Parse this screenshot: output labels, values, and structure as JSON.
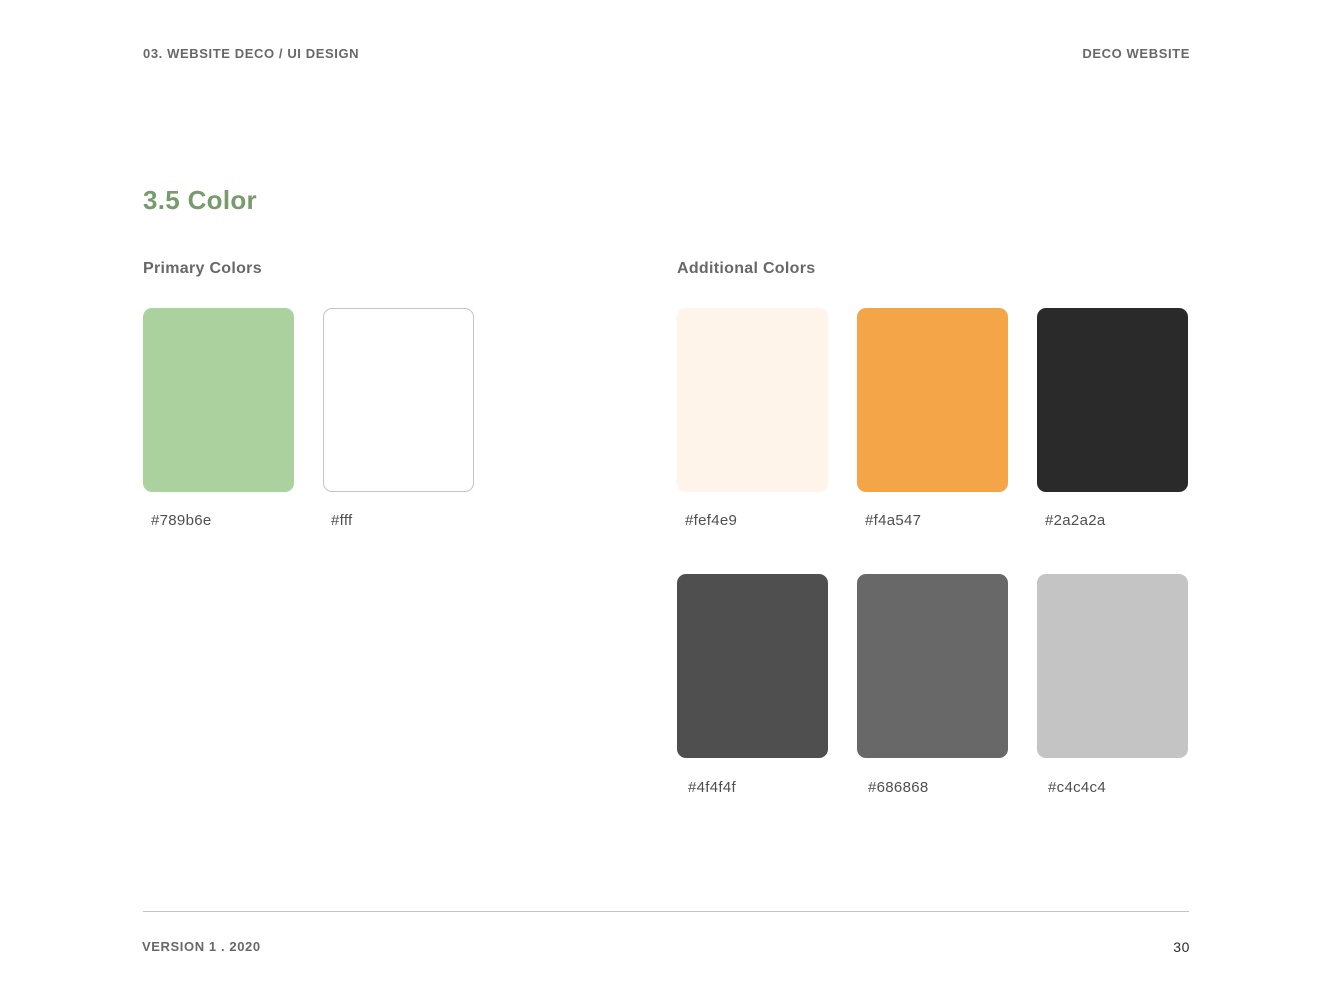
{
  "header": {
    "left": "03. WEBSITE DECO / UI DESIGN",
    "right": "DECO WEBSITE"
  },
  "section": {
    "title": "3.5 Color"
  },
  "primary": {
    "title": "Primary Colors",
    "colors": [
      {
        "label": "#789b6e",
        "fill": "#abd19e"
      },
      {
        "label": "#fff",
        "fill": "#ffffff",
        "border": "#c4c4c4"
      }
    ]
  },
  "additional": {
    "title": "Additional Colors",
    "colors": [
      {
        "label": "#fef4e9",
        "fill": "#fef4e9"
      },
      {
        "label": "#f4a547",
        "fill": "#f4a547"
      },
      {
        "label": "#2a2a2a",
        "fill": "#2a2a2a"
      },
      {
        "label": "#4f4f4f",
        "fill": "#4f4f4f"
      },
      {
        "label": "#686868",
        "fill": "#686868"
      },
      {
        "label": "#c4c4c4",
        "fill": "#c4c4c4"
      }
    ]
  },
  "footer": {
    "version": "VERSION 1 . 2020",
    "page_number": "30"
  }
}
